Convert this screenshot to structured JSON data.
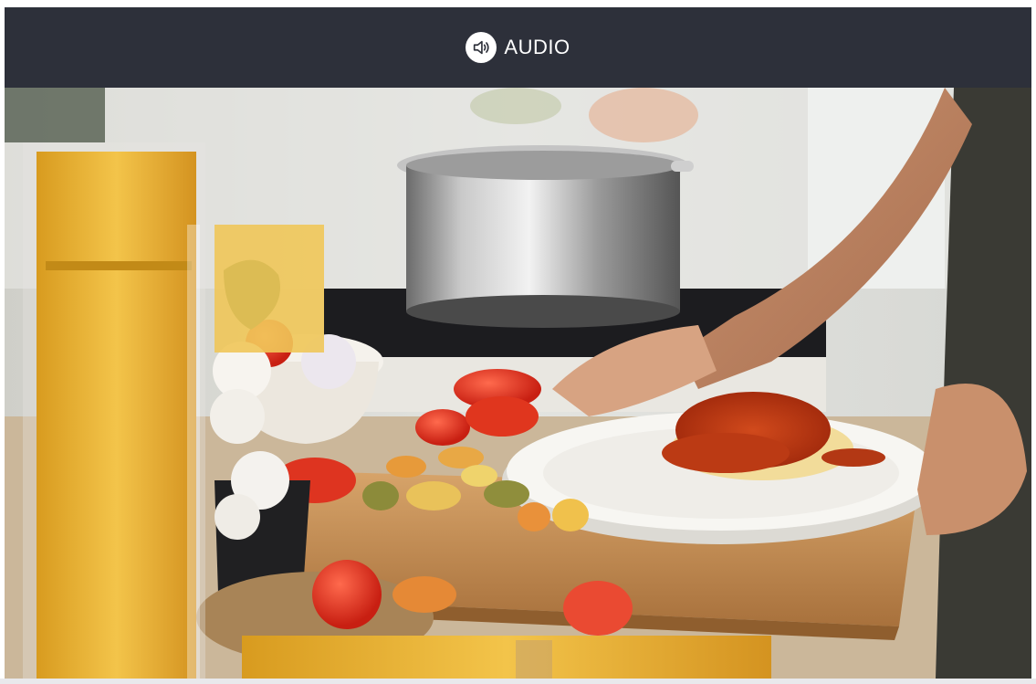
{
  "audio_button": {
    "label": "AUDIO",
    "icon": "speaker-icon"
  },
  "photo": {
    "subject": "cooking-scene-spaghetti-plate"
  },
  "colors": {
    "header_bg": "#2d303a",
    "header_text": "#ffffff"
  }
}
